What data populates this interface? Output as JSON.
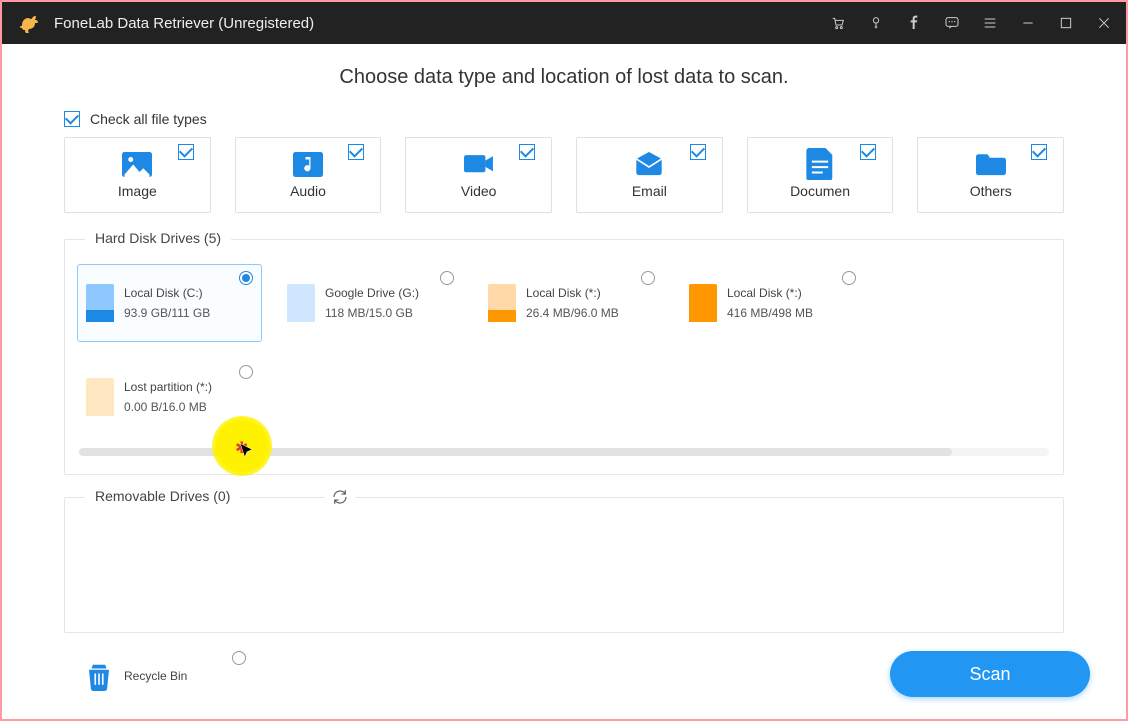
{
  "app_title": "FoneLab Data Retriever (Unregistered)",
  "heading": "Choose data type and location of lost data to scan.",
  "check_all_label": "Check all file types",
  "file_types": [
    {
      "key": "image",
      "label": "Image",
      "checked": true
    },
    {
      "key": "audio",
      "label": "Audio",
      "checked": true
    },
    {
      "key": "video",
      "label": "Video",
      "checked": true
    },
    {
      "key": "email",
      "label": "Email",
      "checked": true
    },
    {
      "key": "document",
      "label": "Documen",
      "checked": true
    },
    {
      "key": "others",
      "label": "Others",
      "checked": true
    }
  ],
  "hdd_group_title": "Hard Disk Drives (5)",
  "hdd": [
    {
      "name": "Local Disk (C:)",
      "size": "93.9 GB/111 GB",
      "color_body": "#8ec8ff",
      "color_bar": "#1e88e5",
      "selected": true
    },
    {
      "name": "Google Drive (G:)",
      "size": "118 MB/15.0 GB",
      "color_body": "#cfe6ff",
      "color_bar": "#cfe6ff",
      "selected": false
    },
    {
      "name": "Local Disk (*:)",
      "size": "26.4 MB/96.0 MB",
      "color_body": "#ffd9a8",
      "color_bar": "#ff9800",
      "selected": false
    },
    {
      "name": "Local Disk (*:)",
      "size": "416 MB/498 MB",
      "color_body": "#ff9800",
      "color_bar": "#ff9800",
      "selected": false
    },
    {
      "name": "Lost partition (*:)",
      "size": "0.00 B/16.0 MB",
      "color_body": "#ffe7c2",
      "color_bar": "#ffe7c2",
      "selected": false
    }
  ],
  "removable_group_title": "Removable Drives (0)",
  "recycle_bin_label": "Recycle Bin",
  "scan_button_label": "Scan"
}
